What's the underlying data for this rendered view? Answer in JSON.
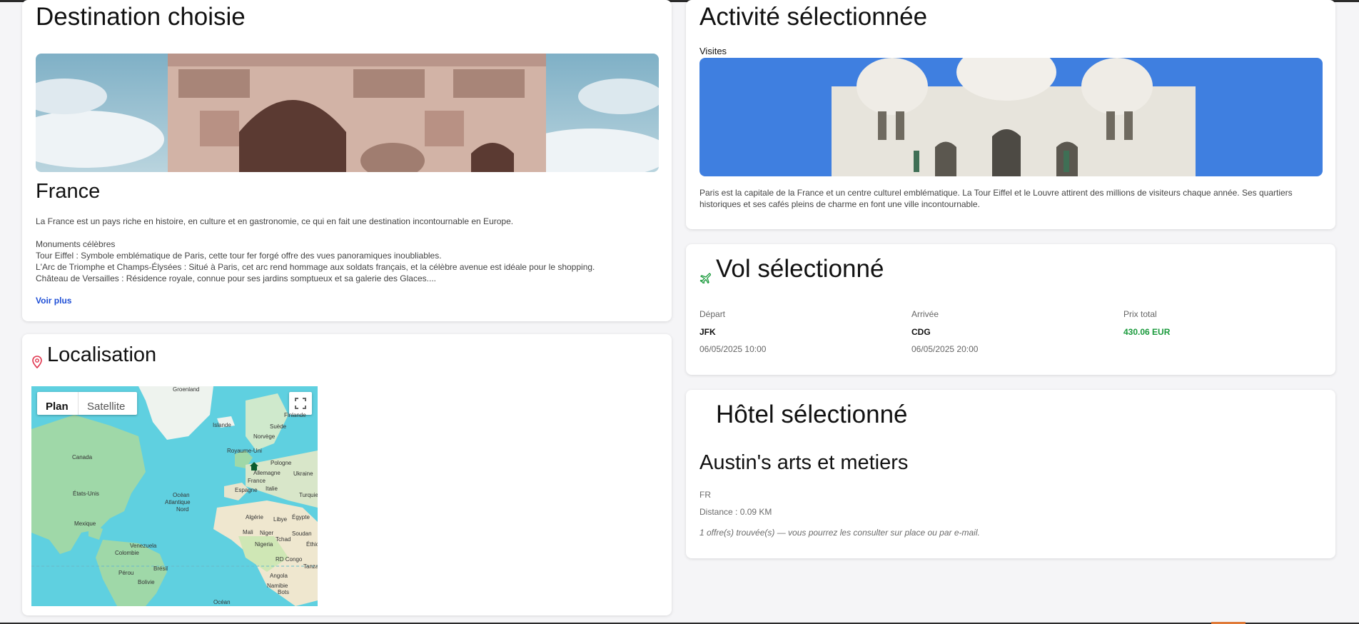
{
  "destination": {
    "heading": "Destination choisie",
    "country": "France",
    "description": "La France est un pays riche en histoire, en culture et en gastronomie, ce qui en fait une destination incontournable en Europe.",
    "monuments_title": "Monuments célèbres",
    "monuments": [
      "Tour Eiffel : Symbole emblématique de Paris, cette tour fer forgé offre des vues panoramiques inoubliables.",
      "L'Arc de Triomphe et Champs-Élysées : Situé à Paris, cet arc rend hommage aux soldats français, et la célèbre avenue est idéale pour le shopping.",
      "Château de Versailles : Résidence royale, connue pour ses jardins somptueux et sa galerie des Glaces...."
    ],
    "more_link": "Voir plus"
  },
  "location": {
    "heading": "Localisation",
    "map": {
      "tab_plan": "Plan",
      "tab_satellite": "Satellite",
      "active_tab": "Plan",
      "labels": [
        "Groenland",
        "Islande",
        "Suède",
        "Finlande",
        "Norvège",
        "Canada",
        "Royaume-Uni",
        "Pologne",
        "Allemagne",
        "Ukraine",
        "France",
        "Italie",
        "Espagne",
        "Turquie",
        "États-Unis",
        "Océan",
        "Atlantique",
        "Nord",
        "Algérie",
        "Libye",
        "Égypte",
        "Mexique",
        "Mali",
        "Niger",
        "Soudan",
        "Éthio",
        "Tchad",
        "Nigeria",
        "Venezuela",
        "Colombie",
        "RD Congo",
        "Tanzan",
        "Brésil",
        "Pérou",
        "Angola",
        "Bolivie",
        "Namibie",
        "Bots",
        "Océan"
      ]
    }
  },
  "activity": {
    "heading": "Activité sélectionnée",
    "category": "Visites",
    "description": "Paris est la capitale de la France et un centre culturel emblématique. La Tour Eiffel et le Louvre attirent des millions de visiteurs chaque année. Ses quartiers historiques et ses cafés pleins de charme en font une ville incontournable."
  },
  "flight": {
    "heading": "Vol sélectionné",
    "departure_label": "Départ",
    "arrival_label": "Arrivée",
    "price_label": "Prix total",
    "departure_code": "JFK",
    "arrival_code": "CDG",
    "price": "430.06 EUR",
    "departure_date": "06/05/2025 10:00",
    "arrival_date": "06/05/2025 20:00"
  },
  "hotel": {
    "heading": "Hôtel sélectionné",
    "name": "Austin's arts et metiers",
    "country_code": "FR",
    "distance": "Distance : 0.09 KM",
    "offers_note": "1 offre(s) trouvée(s) — vous pourrez les consulter sur place ou par e-mail."
  },
  "colors": {
    "link": "#1f4fd6",
    "price": "#1a9a3c",
    "plane_icon": "#1a9a3c",
    "location_icon": "#e0344d",
    "map_water": "#5fd0e0",
    "map_land": "#9fd8a8"
  },
  "icons": {
    "location": "map-pin-icon",
    "flight": "airplane-icon",
    "fullscreen": "fullscreen-icon",
    "hotel_marker": "house-marker-icon"
  }
}
